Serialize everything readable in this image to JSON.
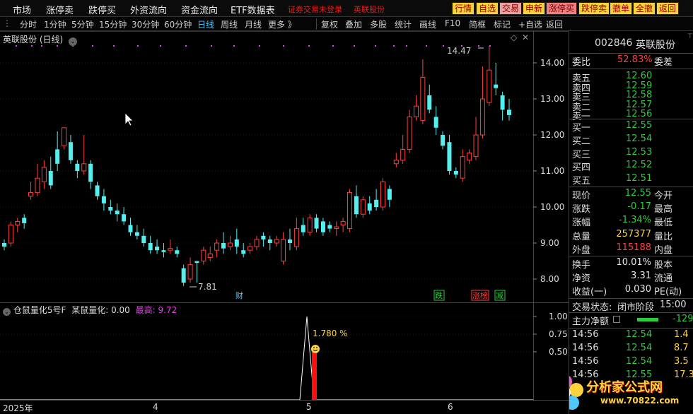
{
  "menu": {
    "items": [
      "市场",
      "涨停卖",
      "跌停买",
      "外资流向",
      "资金流向",
      "ETF数据表"
    ],
    "login_note": "证券交易未登录",
    "stock_note": "英联股份",
    "buttons": [
      "行情",
      "自选",
      "交易",
      "申新",
      "涨停买",
      "跌停卖",
      "撤单",
      "全撤",
      "返回"
    ]
  },
  "toolbar": {
    "periods": [
      "分时",
      "1分钟",
      "5分钟",
      "15分钟",
      "30分钟",
      "60分钟",
      "日线",
      "周线",
      "月线",
      "更多 》"
    ],
    "active_period": "日线",
    "tools": [
      "复权",
      "叠加",
      "多股",
      "统计",
      "画线",
      "F10",
      "简框",
      "标记",
      "+自选",
      "返回"
    ]
  },
  "main": {
    "title": "英联股份 (日线)",
    "high_label": "14.47",
    "low_label": "7.81",
    "event_tags": [
      "财",
      "跌",
      "涨榜",
      "减"
    ]
  },
  "indicator": {
    "name": "仓鼠量化5号F",
    "label": "某鼠量化:",
    "value": "0.00",
    "high_label": "最高:",
    "high_value": "9.72",
    "annotation": "1.780 %"
  },
  "xaxis": {
    "labels": [
      "2025年",
      "4",
      "5",
      "6"
    ]
  },
  "panel": {
    "code": "002846",
    "name": "英联股份",
    "weibi_label": "委比",
    "weibi_value": "52.83%",
    "weicha_label": "委差",
    "asks": [
      {
        "label": "卖五",
        "price": "12.60"
      },
      {
        "label": "卖四",
        "price": "12.59"
      },
      {
        "label": "卖三",
        "price": "12.58"
      },
      {
        "label": "卖二",
        "price": "12.57"
      },
      {
        "label": "卖一",
        "price": "12.56"
      }
    ],
    "bids": [
      {
        "label": "买一",
        "price": "12.55"
      },
      {
        "label": "买二",
        "price": "12.54"
      },
      {
        "label": "买三",
        "price": "12.53"
      },
      {
        "label": "买四",
        "price": "12.52"
      },
      {
        "label": "买五",
        "price": "12.51"
      }
    ],
    "stats": [
      {
        "label": "现价",
        "value": "12.55",
        "right": "今开",
        "color": "green"
      },
      {
        "label": "涨跌",
        "value": "-0.17",
        "right": "最高",
        "color": "green"
      },
      {
        "label": "涨幅",
        "value": "-1.34%",
        "right": "最低",
        "color": "green"
      },
      {
        "label": "总量",
        "value": "257377",
        "right": "量比",
        "color": "yellow"
      },
      {
        "label": "外盘",
        "value": "115188",
        "right": "内盘",
        "color": "red"
      }
    ],
    "stats2": [
      {
        "label": "换手",
        "value": "10.01%",
        "right": "股本",
        "color": "white"
      },
      {
        "label": "净资",
        "value": "3.31",
        "right": "流通",
        "color": "white"
      },
      {
        "label": "收益(一)",
        "value": "0.030",
        "right": "PE(动)",
        "color": "white"
      }
    ],
    "status_label": "交易状态:",
    "status_value": "闭市阶段",
    "status_time": "15:00",
    "flow_label": "主力净额",
    "flow_value": "-129",
    "ticks": [
      {
        "time": "14:56",
        "price": "12.54",
        "vol": "1.4"
      },
      {
        "time": "14:56",
        "price": "12.54",
        "vol": "8.7"
      },
      {
        "time": "14:56",
        "price": "12.54",
        "vol": "3.5"
      },
      {
        "time": "14:56",
        "price": "12.55",
        "vol": "17.3"
      }
    ],
    "watermark_text": "分析家公式网",
    "watermark_url": "www.70822.com"
  },
  "chart_data": {
    "type": "candlestick",
    "price_axis_ticks": [
      8.0,
      9.0,
      10.0,
      11.0,
      12.0,
      13.0,
      14.0
    ],
    "indicator_axis_ticks": [
      0.5,
      0.75,
      1.0
    ],
    "candles": [
      [
        9.0,
        8.9,
        9.1,
        8.8
      ],
      [
        9.0,
        9.5,
        9.6,
        8.9
      ],
      [
        9.5,
        9.6,
        9.7,
        9.3
      ],
      [
        9.7,
        9.55,
        9.8,
        9.4
      ],
      [
        10.3,
        10.4,
        10.7,
        10.2
      ],
      [
        10.4,
        10.8,
        11.2,
        10.3
      ],
      [
        10.7,
        11.1,
        11.3,
        10.5
      ],
      [
        11.0,
        10.6,
        11.4,
        10.5
      ],
      [
        11.6,
        11.2,
        12.1,
        11.0
      ],
      [
        11.7,
        12.2,
        12.2,
        11.6
      ],
      [
        11.8,
        11.3,
        12.0,
        11.2
      ],
      [
        11.2,
        11.0,
        11.3,
        10.8
      ],
      [
        11.0,
        11.2,
        12.0,
        10.9
      ],
      [
        11.2,
        10.7,
        11.3,
        10.5
      ],
      [
        10.6,
        10.3,
        10.7,
        10.2
      ],
      [
        10.3,
        10.1,
        10.5,
        9.9
      ],
      [
        10.0,
        9.9,
        10.2,
        9.8
      ],
      [
        9.9,
        9.8,
        10.1,
        9.6
      ],
      [
        9.8,
        9.6,
        10.0,
        9.5
      ],
      [
        9.5,
        9.3,
        9.7,
        9.2
      ],
      [
        9.3,
        9.2,
        9.5,
        9.1
      ],
      [
        9.2,
        9.0,
        9.4,
        8.9
      ],
      [
        9.0,
        8.8,
        9.2,
        8.7
      ],
      [
        8.9,
        8.8,
        9.1,
        8.7
      ],
      [
        8.8,
        8.75,
        9.0,
        8.6
      ],
      [
        8.8,
        8.85,
        9.1,
        8.7
      ],
      [
        8.8,
        8.7,
        8.9,
        8.6
      ],
      [
        8.3,
        7.9,
        8.4,
        7.81
      ],
      [
        8.0,
        8.4,
        8.6,
        7.9
      ],
      [
        8.5,
        8.45,
        8.5,
        7.9
      ],
      [
        8.5,
        8.8,
        8.9,
        8.4
      ],
      [
        8.6,
        8.7,
        8.9,
        8.5
      ],
      [
        8.8,
        9.0,
        9.1,
        8.6
      ],
      [
        9.0,
        8.85,
        9.3,
        8.7
      ],
      [
        8.9,
        9.0,
        9.2,
        8.8
      ],
      [
        9.1,
        8.9,
        9.4,
        8.7
      ],
      [
        8.8,
        8.7,
        9.0,
        8.6
      ],
      [
        8.8,
        8.9,
        9.0,
        8.7
      ],
      [
        8.9,
        9.1,
        9.2,
        8.8
      ],
      [
        9.2,
        9.1,
        9.3,
        8.9
      ],
      [
        9.1,
        9.0,
        9.2,
        8.8
      ],
      [
        9.0,
        9.1,
        9.2,
        8.9
      ],
      [
        8.5,
        9.1,
        9.3,
        8.4
      ],
      [
        9.1,
        9.0,
        9.4,
        8.8
      ],
      [
        8.9,
        9.4,
        9.7,
        8.8
      ],
      [
        9.5,
        9.3,
        9.7,
        9.2
      ],
      [
        9.3,
        9.7,
        9.8,
        9.2
      ],
      [
        9.7,
        9.4,
        9.8,
        9.3
      ],
      [
        9.6,
        9.3,
        9.7,
        9.2
      ],
      [
        9.5,
        9.4,
        9.6,
        9.3
      ],
      [
        9.4,
        9.45,
        9.6,
        9.2
      ],
      [
        9.5,
        9.6,
        9.7,
        9.3
      ],
      [
        9.4,
        10.4,
        10.5,
        9.3
      ],
      [
        10.3,
        9.8,
        10.6,
        9.7
      ],
      [
        9.8,
        10.2,
        10.3,
        9.7
      ],
      [
        10.1,
        9.9,
        10.3,
        9.8
      ],
      [
        10.2,
        10.0,
        10.5,
        9.9
      ],
      [
        10.0,
        10.7,
        10.8,
        9.9
      ],
      [
        10.5,
        10.2,
        10.6,
        10.0
      ],
      [
        11.2,
        11.3,
        11.5,
        11.1
      ],
      [
        11.3,
        11.6,
        12.0,
        11.2
      ],
      [
        11.6,
        12.5,
        12.7,
        11.5
      ],
      [
        12.5,
        12.8,
        13.1,
        12.4
      ],
      [
        12.4,
        13.6,
        14.1,
        12.3
      ],
      [
        13.1,
        12.7,
        13.4,
        12.6
      ],
      [
        12.5,
        12.2,
        12.8,
        12.0
      ],
      [
        12.0,
        11.7,
        12.1,
        11.6
      ],
      [
        11.8,
        11.0,
        12.0,
        10.9
      ],
      [
        11.0,
        10.9,
        11.1,
        10.8
      ],
      [
        10.8,
        11.4,
        11.6,
        10.7
      ],
      [
        11.3,
        11.5,
        11.6,
        11.2
      ],
      [
        11.4,
        12.0,
        12.5,
        11.3
      ],
      [
        12.0,
        13.0,
        13.9,
        11.9
      ],
      [
        12.9,
        13.8,
        14.47,
        12.8
      ],
      [
        13.4,
        13.3,
        14.0,
        13.1
      ],
      [
        13.1,
        12.7,
        13.2,
        12.4
      ],
      [
        12.7,
        12.55,
        13.0,
        12.4
      ]
    ],
    "signal": {
      "peak": 1.0,
      "bar": 0.5
    }
  }
}
